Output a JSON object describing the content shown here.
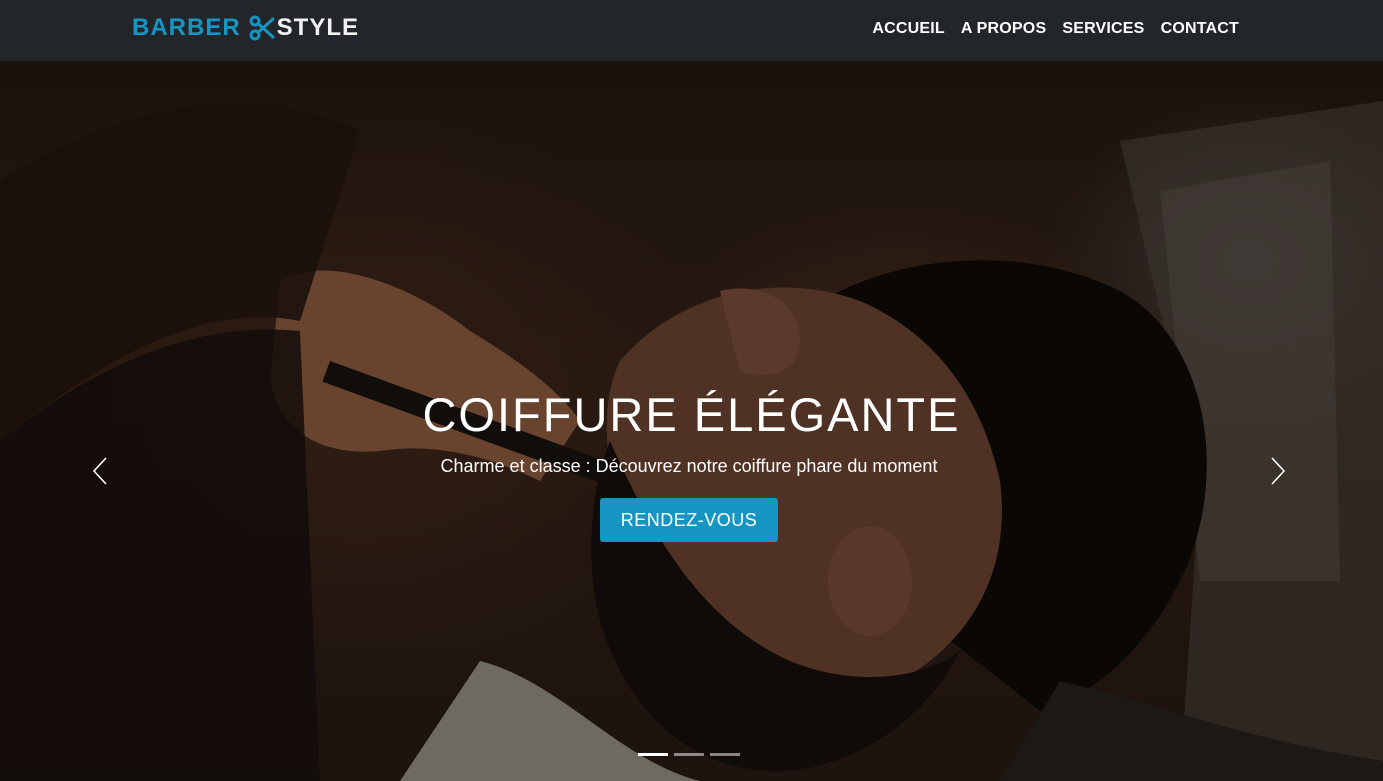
{
  "brand": {
    "name_part1": "BARBER",
    "name_part2": "STYLE",
    "logo_icon": "scissors-icon",
    "accent_color": "#1795c2"
  },
  "nav": {
    "items": [
      {
        "label": "ACCUEIL"
      },
      {
        "label": "A PROPOS"
      },
      {
        "label": "SERVICES"
      },
      {
        "label": "CONTACT"
      }
    ]
  },
  "hero": {
    "title": "COIFFURE ÉLÉGANTE",
    "subtitle": "Charme et classe : Découvrez notre coiffure phare du moment",
    "cta_label": "RENDEZ-VOUS",
    "image": "man-getting-beard-trimmed-photo",
    "prev_icon": "chevron-left-icon",
    "next_icon": "chevron-right-icon",
    "slide_count": 3,
    "active_slide": 1
  }
}
